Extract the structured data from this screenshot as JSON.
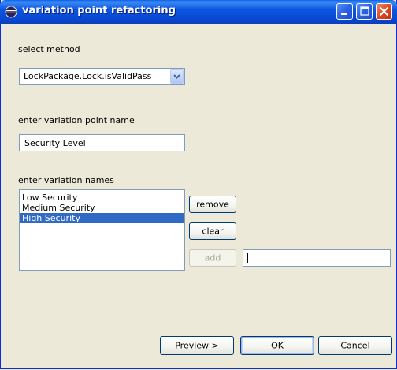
{
  "window": {
    "title": "variation point refactoring",
    "icon": "eclipse-icon"
  },
  "title_buttons": {
    "minimize": "minimize-icon",
    "maximize": "maximize-icon",
    "close": "close-icon"
  },
  "method": {
    "label": "select method",
    "selected": "LockPackage.Lock.isValidPass"
  },
  "variation_point": {
    "label": "enter variation point name",
    "value": "Security Level"
  },
  "variations": {
    "label": "enter variation names",
    "items": [
      "Low Security",
      "Medium Security",
      "High Security"
    ],
    "selected_index": 2,
    "new_value": ""
  },
  "buttons": {
    "remove": "remove",
    "clear": "clear",
    "add": "add",
    "preview": "Preview >",
    "ok": "OK",
    "cancel": "Cancel"
  },
  "colors": {
    "titlebar": "#0b56e0",
    "selection": "#316ac5",
    "dialog_bg": "#ece9d8"
  }
}
